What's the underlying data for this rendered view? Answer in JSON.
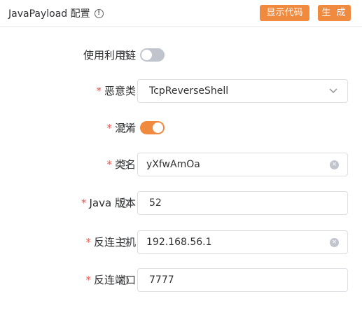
{
  "header": {
    "title": "JavaPayload 配置",
    "show_code_label": "显示代码",
    "generate_label": "生 成"
  },
  "form": {
    "use_chain": {
      "label": "使用利用链",
      "enabled": false
    },
    "malicious_class": {
      "label": "恶意类",
      "value": "TcpReverseShell"
    },
    "obfuscate": {
      "label": "混淆",
      "enabled": true
    },
    "class_name": {
      "label": "类名",
      "value": "yXfwAmOa"
    },
    "java_version": {
      "label": "Java 版本",
      "value": "52"
    },
    "reverse_host": {
      "label": "反连主机",
      "value": "192.168.56.1"
    },
    "reverse_port": {
      "label": "反连端口",
      "value": "7777"
    }
  },
  "colors": {
    "accent": "#f08a3f",
    "required": "#e8584f",
    "switch_off": "#c0c4cc"
  },
  "icons": {
    "info": "info-circle-icon",
    "dropdown": "chevron-down-icon",
    "clear": "clear-circle-icon"
  },
  "glyphs": {
    "required_mark": "*",
    "info": "!",
    "clear": "×"
  }
}
